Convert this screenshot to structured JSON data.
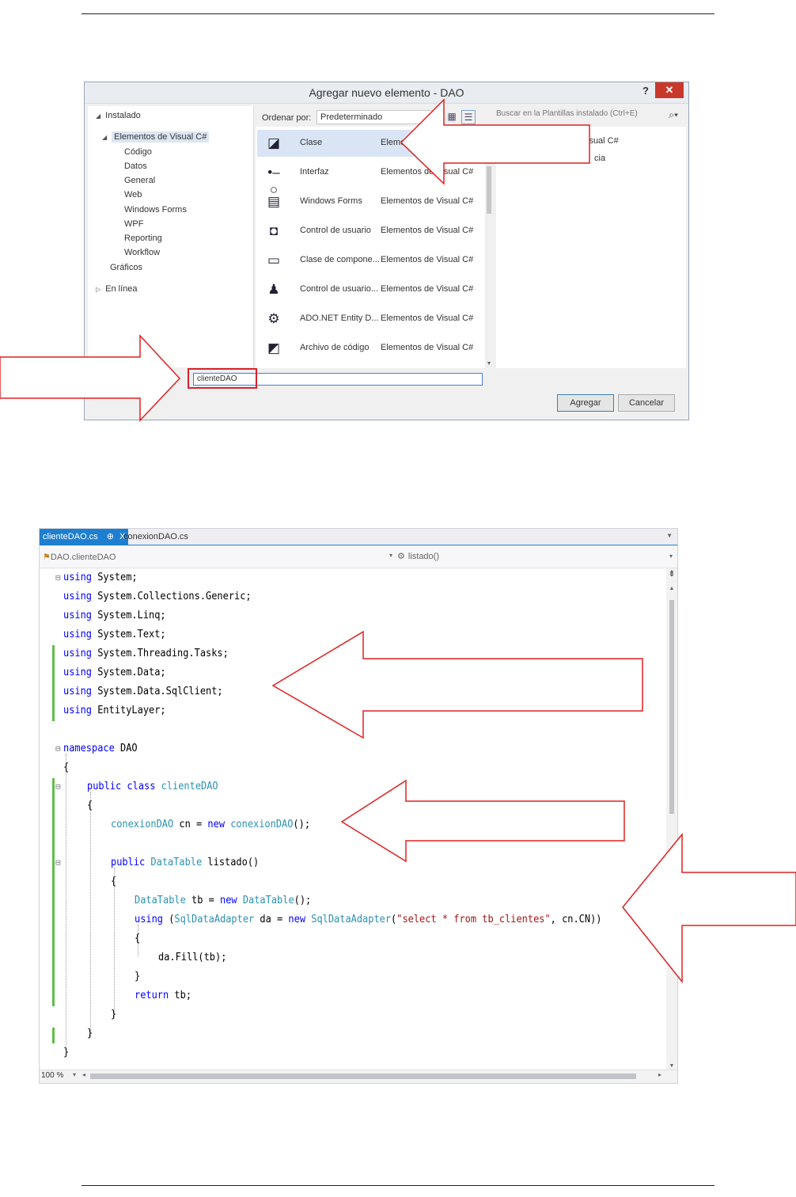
{
  "dialog": {
    "title": "Agregar nuevo elemento - DAO",
    "help_label": "?",
    "close_label": "✕",
    "tree": {
      "installed": "Instalado",
      "visual_csharp": "Elementos de Visual C#",
      "children": [
        "Código",
        "Datos",
        "General",
        "Web",
        "Windows Forms",
        "WPF",
        "Reporting",
        "Workflow"
      ],
      "graphics": "Gráficos",
      "online": "En línea"
    },
    "sort_label": "Ordenar por:",
    "sort_value": "Predeterminado",
    "search_placeholder": "Buscar en la Plantillas instalado (Ctrl+E)",
    "items": [
      {
        "name": "Clase",
        "category": "Eleme",
        "icon": "class-icon"
      },
      {
        "name": "Interfaz",
        "category": "Elementos de Visual C#",
        "icon": "interface-icon"
      },
      {
        "name": "Windows Forms",
        "category": "Elementos de Visual C#",
        "icon": "form-icon"
      },
      {
        "name": "Control de usuario",
        "category": "Elementos de Visual C#",
        "icon": "user-control-icon"
      },
      {
        "name": "Clase de compone...",
        "category": "Elementos de Visual C#",
        "icon": "component-icon"
      },
      {
        "name": "Control de usuario...",
        "category": "Elementos de Visual C#",
        "icon": "wpf-user-control-icon"
      },
      {
        "name": "ADO.NET Entity D...",
        "category": "Elementos de Visual C#",
        "icon": "entity-model-icon"
      },
      {
        "name": "Archivo de código",
        "category": "Elementos de Visual C#",
        "icon": "code-file-icon"
      }
    ],
    "right_pane": {
      "line1": "isual C#",
      "line2": "cia"
    },
    "name_value": "clienteDAO",
    "add_label": "Agregar",
    "cancel_label": "Cancelar"
  },
  "editor": {
    "tabs": [
      {
        "label": "clienteDAO.cs",
        "pin": "⊕",
        "close": "X"
      },
      {
        "label": "conexionDAO.cs"
      }
    ],
    "nav_class": "DAO.clienteDAO",
    "nav_member": "listado()",
    "zoom": "100 %",
    "fold_collapse": "⊟",
    "brace_open": "{",
    "brace_close": "}",
    "kw": {
      "using": "using",
      "namespace": "namespace",
      "public": "public",
      "class": "class",
      "new": "new",
      "return": "return"
    },
    "ident": {
      "System": "System;",
      "Generic": "System.Collections.Generic;",
      "Linq": "System.Linq;",
      "Text": "System.Text;",
      "Tasks": "System.Threading.Tasks;",
      "Data": "System.Data;",
      "SqlClient": "System.Data.SqlClient;",
      "EntityLayer": "EntityLayer;",
      "DAO": "DAO",
      "clienteDAO": "clienteDAO",
      "conexionDAO": "conexionDAO",
      "cn_eq": "cn =",
      "ctor_end": "();",
      "DataTable": "DataTable",
      "listado": "listado()",
      "tb_eq": "tb =",
      "paren_open": "(",
      "SqlDataAdapter": "SqlDataAdapter",
      "da_eq": "da =",
      "sql": "\"select * from tb_clientes\"",
      "conn_arg": ", cn.CN))",
      "fill": "da.Fill(tb);",
      "tb_ret": "tb;"
    }
  }
}
